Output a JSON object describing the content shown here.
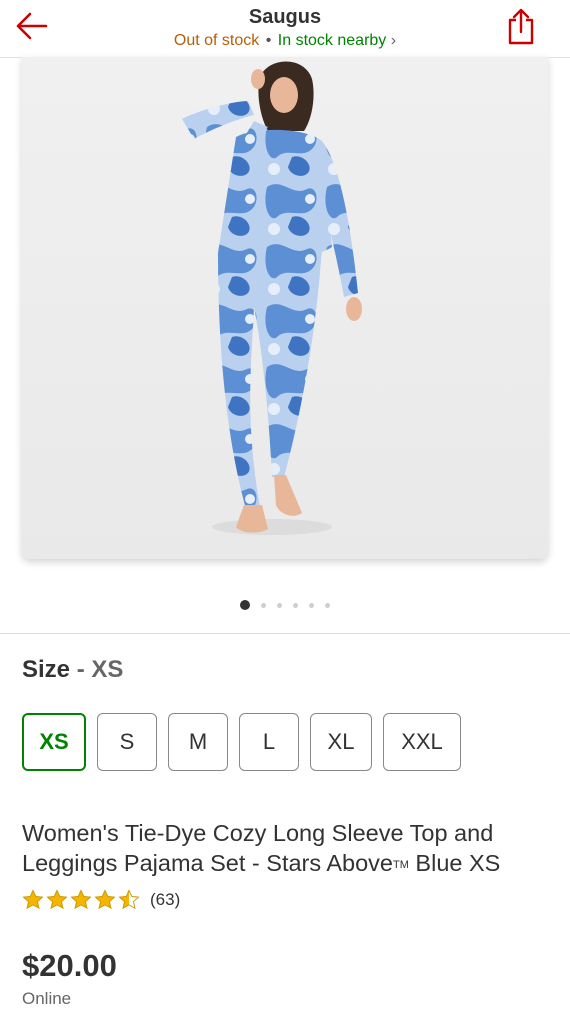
{
  "header": {
    "store_name": "Saugus",
    "stock_status": "Out of stock",
    "separator": "•",
    "nearby_status": "In stock nearby",
    "chevron": "›"
  },
  "gallery": {
    "image_count": 6,
    "active_index": 0
  },
  "size": {
    "label": "Size",
    "separator": "-",
    "selected": "XS",
    "options": [
      "XS",
      "S",
      "M",
      "L",
      "XL",
      "XXL"
    ]
  },
  "product": {
    "title_main": "Women's Tie-Dye Cozy Long Sleeve Top and Leggings Pajama Set - Stars Above",
    "trademark": "TM",
    "title_end": " Blue XS",
    "rating": 4.5,
    "review_count": "(63)",
    "price": "$20.00",
    "channel": "Online"
  },
  "colors": {
    "brand_red": "#cc0000",
    "in_stock_green": "#008300",
    "out_of_stock_orange": "#b5600b",
    "star_gold": "#f5b400"
  },
  "icons": {
    "back": "back-arrow-icon",
    "share": "share-icon",
    "favorite": "heart-icon",
    "star": "star-icon"
  }
}
